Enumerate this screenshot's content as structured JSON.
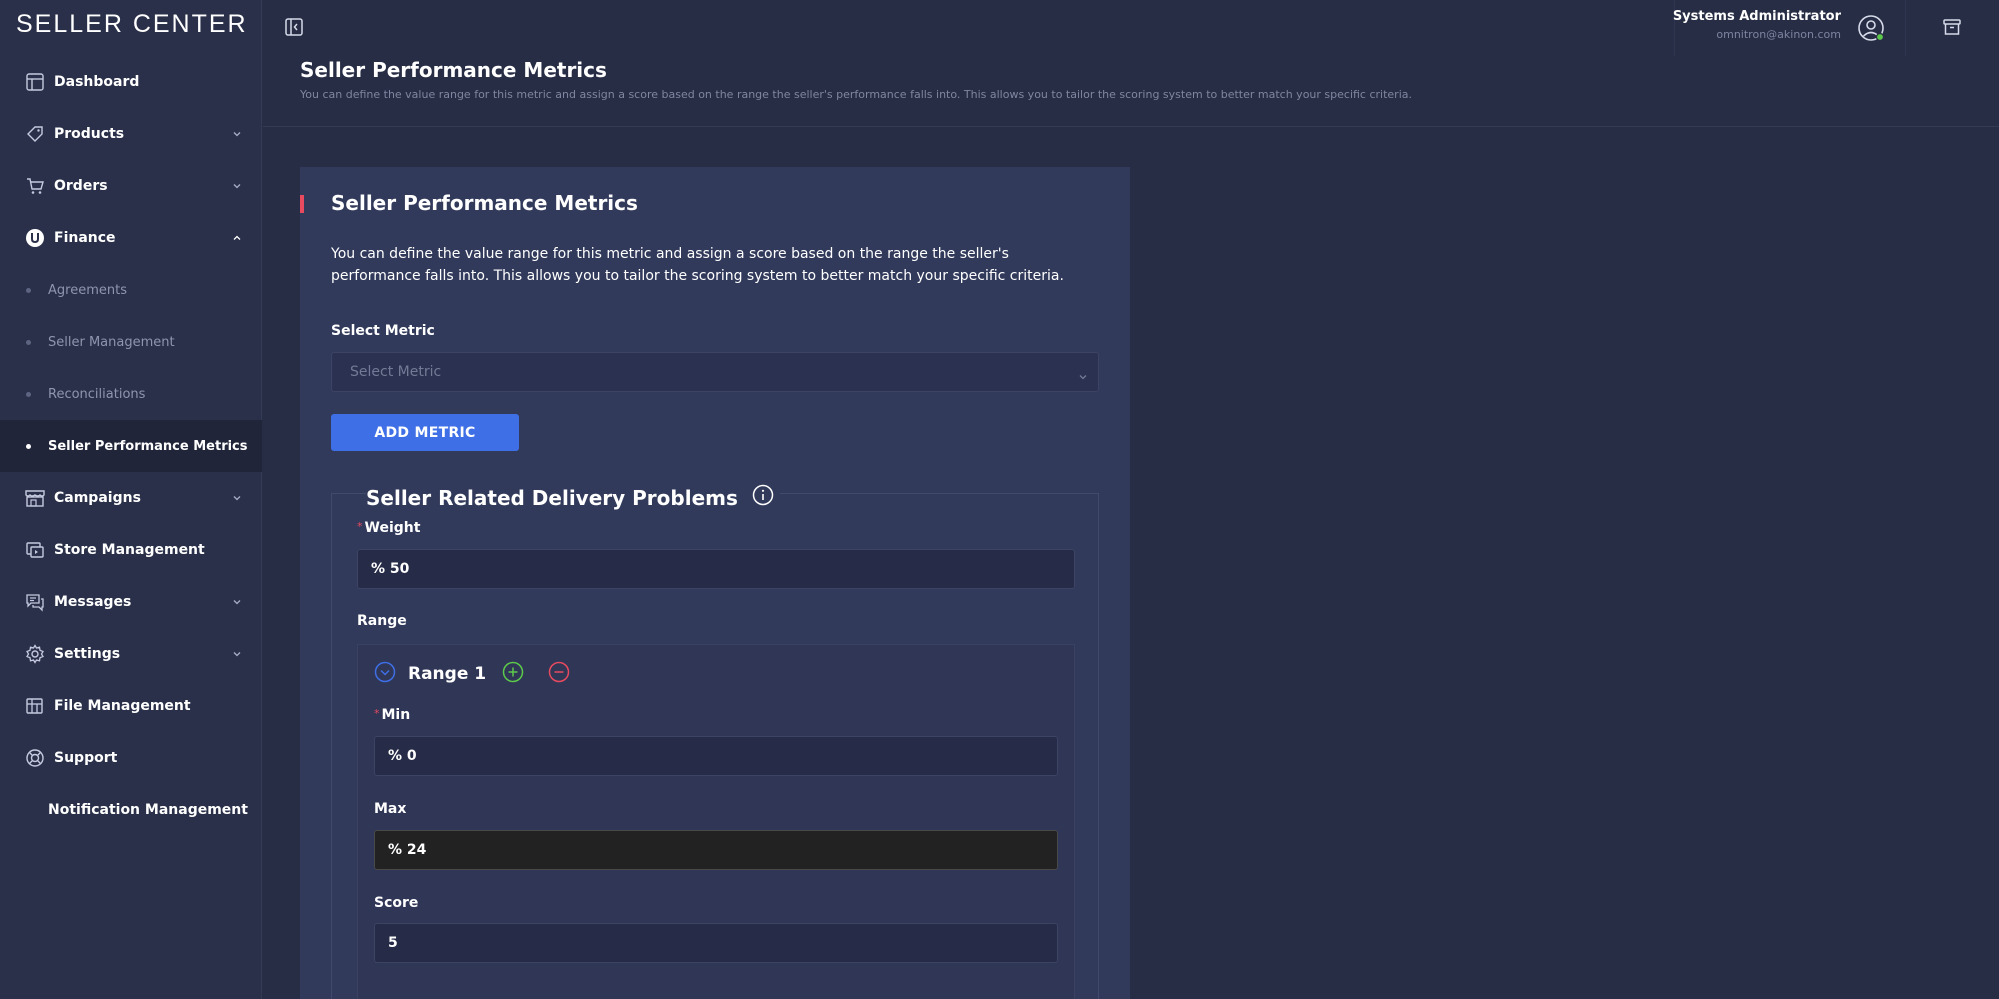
{
  "brand": "SELLER CENTER",
  "sidebar": {
    "items": [
      {
        "label": "Dashboard"
      },
      {
        "label": "Products"
      },
      {
        "label": "Orders"
      },
      {
        "label": "Finance"
      },
      {
        "label": "Campaigns"
      },
      {
        "label": "Store Management"
      },
      {
        "label": "Messages"
      },
      {
        "label": "Settings"
      },
      {
        "label": "File Management"
      },
      {
        "label": "Support"
      },
      {
        "label": "Notification Management"
      }
    ],
    "finance_sub": [
      {
        "label": "Agreements"
      },
      {
        "label": "Seller Management"
      },
      {
        "label": "Reconciliations"
      },
      {
        "label": "Seller Performance Metrics"
      }
    ]
  },
  "topbar": {
    "user_name": "Systems Administrator",
    "user_email": "omnitron@akinon.com"
  },
  "header": {
    "title": "Seller Performance Metrics",
    "description": "You can define the value range for this metric and assign a score based on the range the seller's performance falls into. This allows you to tailor the scoring system to better match your specific criteria."
  },
  "card": {
    "title": "Seller Performance Metrics",
    "description": "You can define the value range for this metric and assign a score based on the range the seller's performance falls into. This allows you to tailor the scoring system to better match your specific criteria.",
    "select_label": "Select Metric",
    "select_placeholder": "Select Metric",
    "add_button": "ADD METRIC",
    "metric": {
      "title": "Seller Related Delivery Problems",
      "weight_label": "Weight",
      "weight_value": "% 50",
      "range_label": "Range",
      "range": {
        "title": "Range 1",
        "min_label": "Min",
        "min_value": "% 0",
        "max_label": "Max",
        "max_value": "% 24",
        "score_label": "Score",
        "score_value": "5"
      }
    }
  },
  "colors": {
    "accent": "#3f6fe6",
    "required": "#e84a5f",
    "add_icon": "#5cc94a",
    "remove_icon": "#e84a5f",
    "online": "#5cc94a"
  }
}
